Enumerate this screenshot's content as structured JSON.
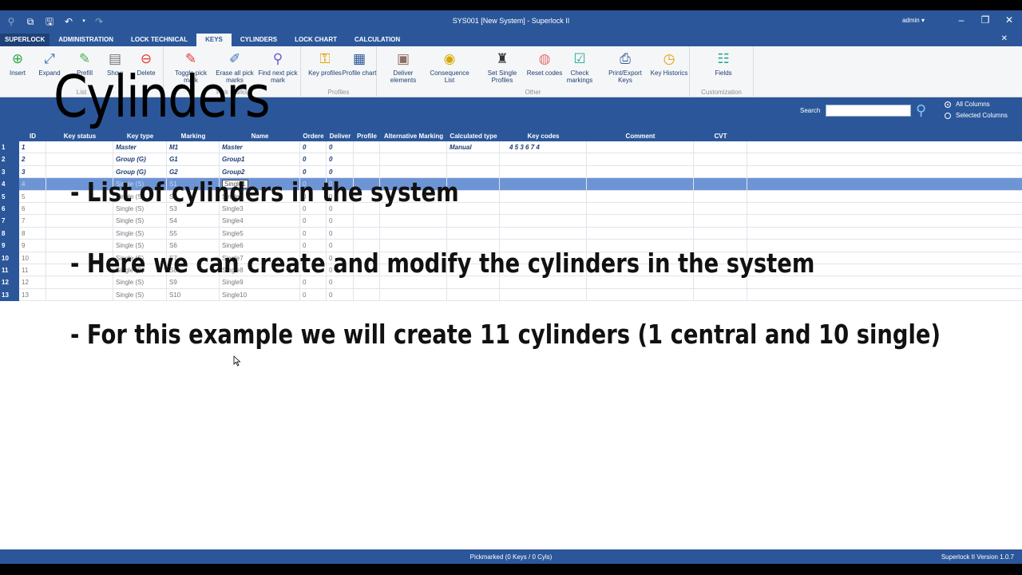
{
  "window": {
    "title": "SYS001 [New System] - Superlock II",
    "user": "admin ▾"
  },
  "tabs": [
    "SUPERLOCK",
    "ADMINISTRATION",
    "LOCK TECHNICAL",
    "KEYS",
    "CYLINDERS",
    "LOCK CHART",
    "CALCULATION"
  ],
  "ribbon": {
    "list": {
      "label": "List",
      "insert": "Insert",
      "expand": "Expand",
      "prefill": "Prefill",
      "show": "Show",
      "delete": "Delete"
    },
    "pickmarks": {
      "label": "Pick marks",
      "toggle": "Toggle pick mark",
      "erase": "Erase all pick marks",
      "find": "Find next pick mark"
    },
    "profiles": {
      "label": "Profiles",
      "key_profiles": "Key profiles",
      "profile_chart": "Profile chart"
    },
    "other": {
      "label": "Other",
      "deliver": "Deliver elements",
      "consequence": "Consequence List",
      "set_single": "Set Single Profiles",
      "reset": "Reset codes",
      "check": "Check markings",
      "print": "Print/Export Keys",
      "historics": "Key Historics"
    },
    "custom": {
      "label": "Customization",
      "fields": "Fields"
    }
  },
  "search": {
    "label": "Search",
    "value": "",
    "opt_all": "All Columns",
    "opt_selected": "Selected Columns"
  },
  "grid": {
    "columns": [
      "ID",
      "Key status",
      "Key type",
      "Marking",
      "Name",
      "Ordere",
      "Deliver",
      "Profile",
      "Alternative Marking",
      "Calculated type",
      "Key codes",
      "Comment",
      "CVT"
    ],
    "rows": [
      {
        "n": "1",
        "id": "1",
        "type": "Master",
        "marking": "M1",
        "name": "Master",
        "ord": "0",
        "del": "0",
        "calc": "Manual",
        "codes": "4   5   3   6   7   4"
      },
      {
        "n": "2",
        "id": "2",
        "type": "Group (G)",
        "marking": "G1",
        "name": "Group1",
        "ord": "0",
        "del": "0",
        "calc": "",
        "codes": ""
      },
      {
        "n": "3",
        "id": "3",
        "type": "Group (G)",
        "marking": "G2",
        "name": "Group2",
        "ord": "0",
        "del": "0",
        "calc": "",
        "codes": ""
      },
      {
        "n": "4",
        "id": "4",
        "type": "Single (S)",
        "marking": "S1",
        "name": "Single1",
        "ord": "0",
        "del": "0",
        "calc": "",
        "codes": ""
      },
      {
        "n": "5",
        "id": "5",
        "type": "Single (S)",
        "marking": "S2",
        "name": "Single2",
        "ord": "0",
        "del": "0",
        "calc": "",
        "codes": ""
      },
      {
        "n": "6",
        "id": "6",
        "type": "Single (S)",
        "marking": "S3",
        "name": "Single3",
        "ord": "0",
        "del": "0",
        "calc": "",
        "codes": ""
      },
      {
        "n": "7",
        "id": "7",
        "type": "Single (S)",
        "marking": "S4",
        "name": "Single4",
        "ord": "0",
        "del": "0",
        "calc": "",
        "codes": ""
      },
      {
        "n": "8",
        "id": "8",
        "type": "Single (S)",
        "marking": "S5",
        "name": "Single5",
        "ord": "0",
        "del": "0",
        "calc": "",
        "codes": ""
      },
      {
        "n": "9",
        "id": "9",
        "type": "Single (S)",
        "marking": "S6",
        "name": "Single6",
        "ord": "0",
        "del": "0",
        "calc": "",
        "codes": ""
      },
      {
        "n": "10",
        "id": "10",
        "type": "Single (S)",
        "marking": "S7",
        "name": "Single7",
        "ord": "0",
        "del": "0",
        "calc": "",
        "codes": ""
      },
      {
        "n": "11",
        "id": "11",
        "type": "Single (S)",
        "marking": "S8",
        "name": "Single8",
        "ord": "0",
        "del": "0",
        "calc": "",
        "codes": ""
      },
      {
        "n": "12",
        "id": "12",
        "type": "Single (S)",
        "marking": "S9",
        "name": "Single9",
        "ord": "0",
        "del": "0",
        "calc": "",
        "codes": ""
      },
      {
        "n": "13",
        "id": "13",
        "type": "Single (S)",
        "marking": "S10",
        "name": "Single10",
        "ord": "0",
        "del": "0",
        "calc": "",
        "codes": ""
      }
    ]
  },
  "overlay": {
    "title": "Cylinders",
    "line1": "- List of cylinders in the system",
    "line2": "- Here we can create and modify the cylinders in the system",
    "line3": "- For this example we will create 11 cylinders (1 central and 10 single)"
  },
  "status": {
    "center": "Pickmarked (0 Keys / 0 Cyls)",
    "right": "Superlock II  Version  1.0.7"
  }
}
